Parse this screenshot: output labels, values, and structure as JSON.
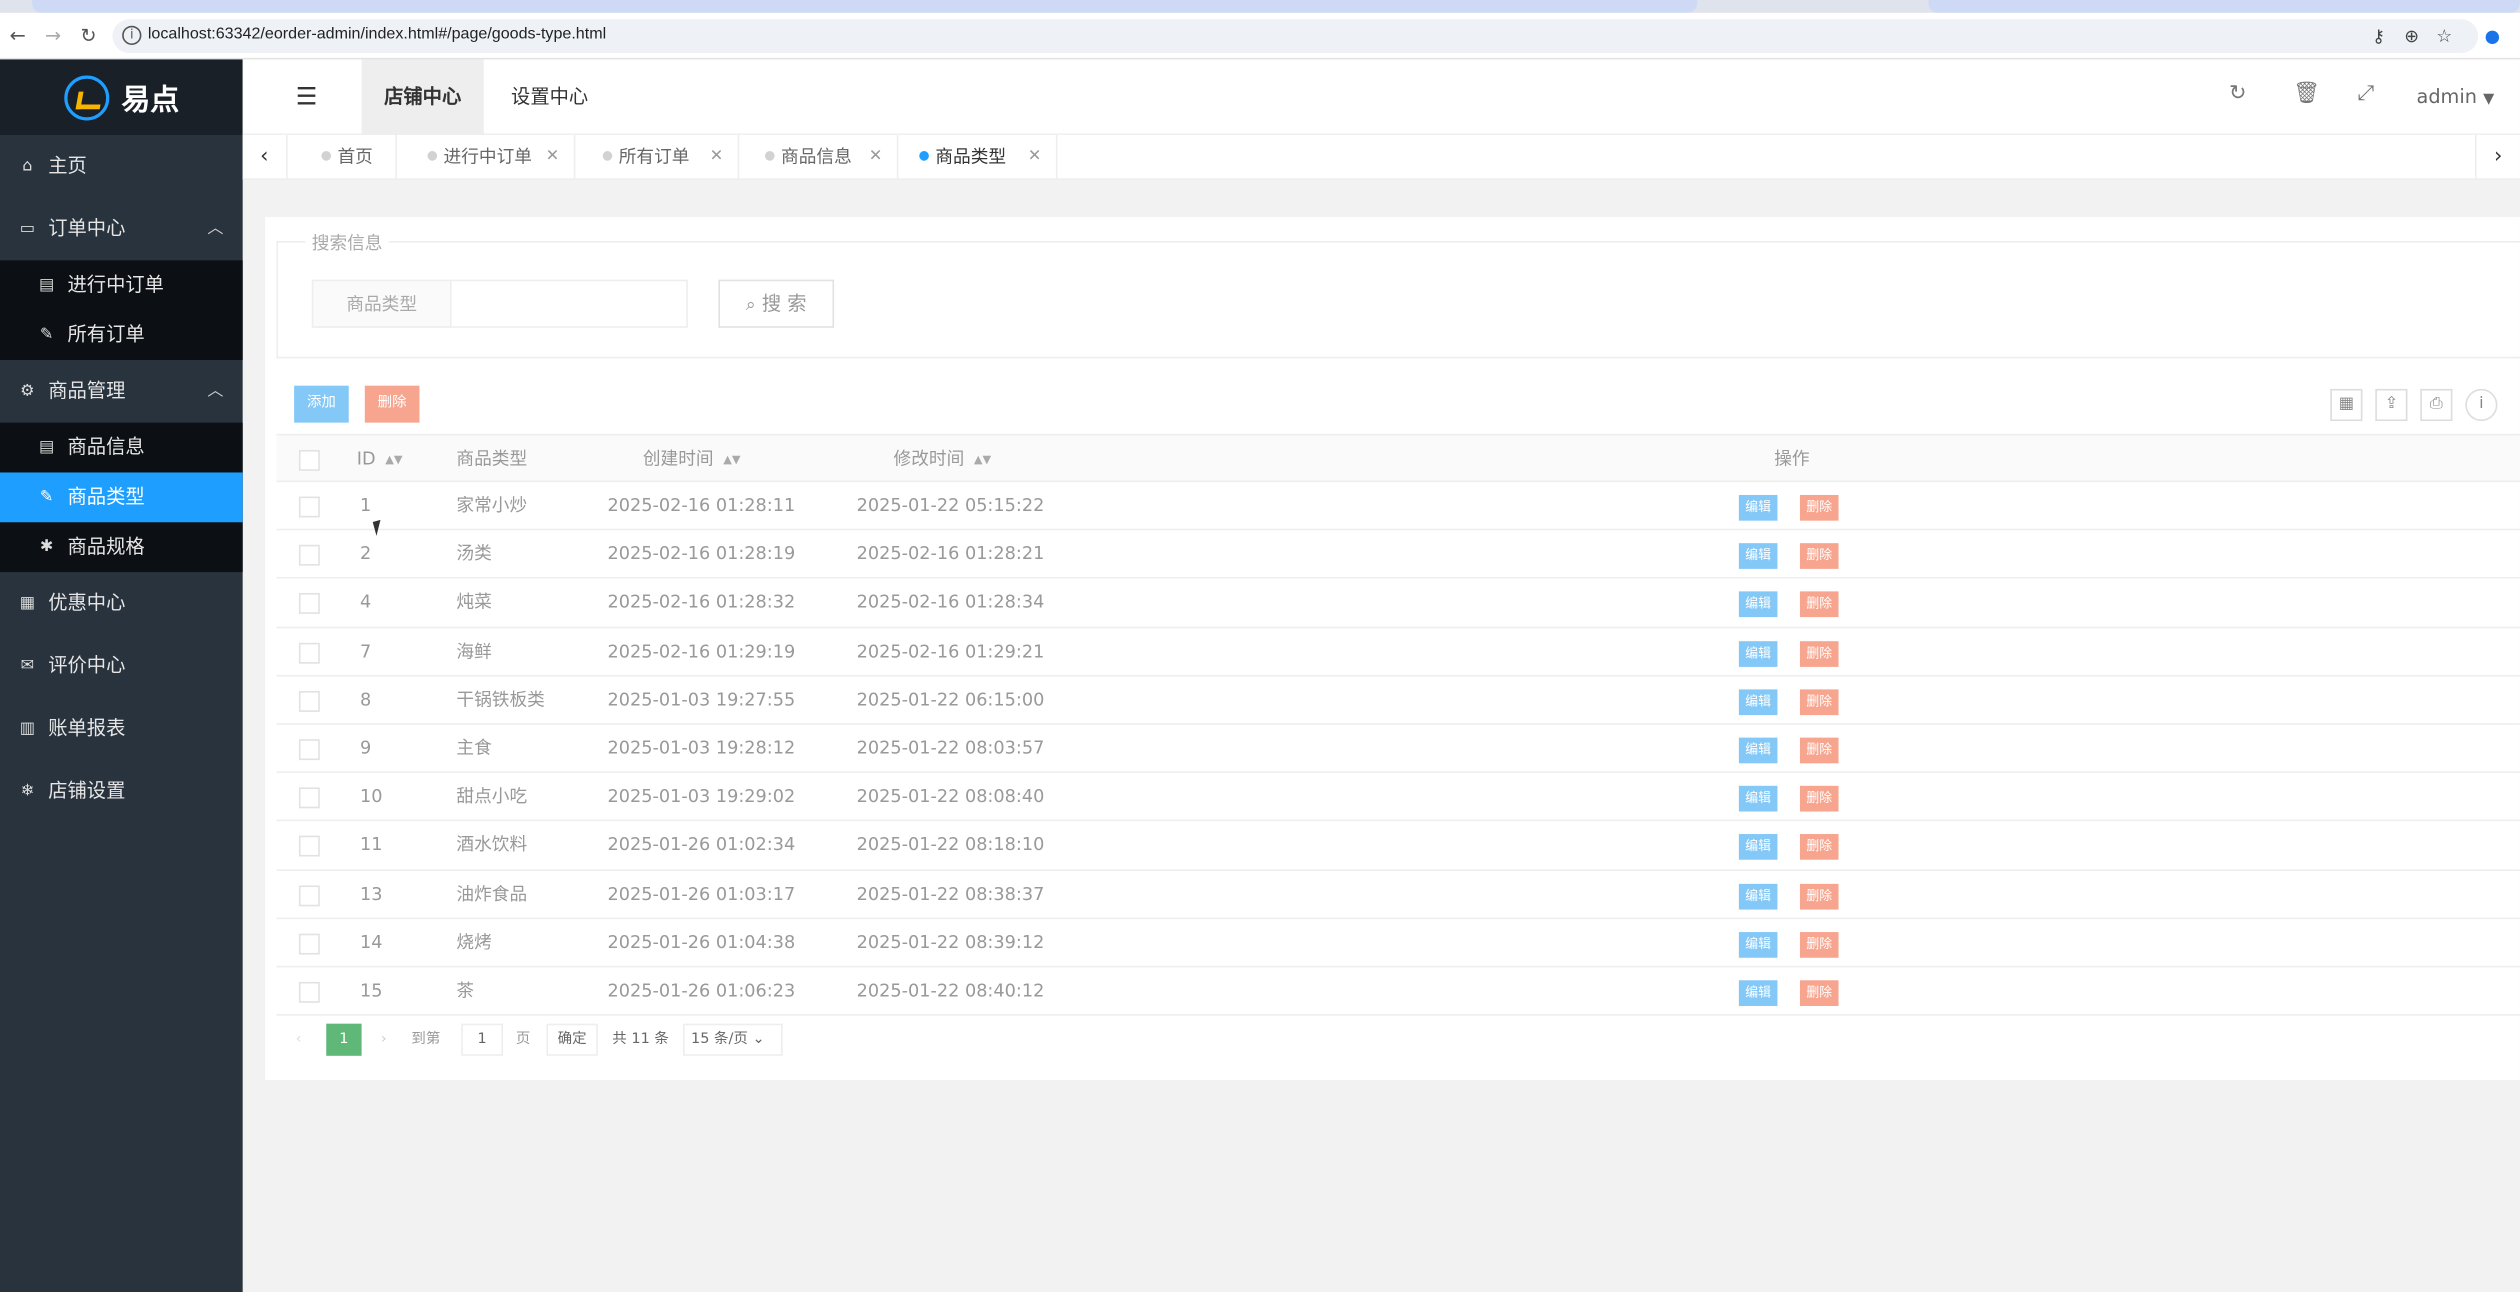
{
  "browser": {
    "url": "localhost:63342/eorder-admin/index.html#/page/goods-type.html"
  },
  "brand": {
    "name": "易点"
  },
  "sidebar": {
    "items": [
      {
        "label": "主页",
        "icon": "home-icon"
      },
      {
        "label": "订单中心",
        "icon": "window-icon",
        "expanded": true
      },
      {
        "label": "进行中订单",
        "icon": "file-icon",
        "sub": true
      },
      {
        "label": "所有订单",
        "icon": "pencil-icon",
        "sub": true
      },
      {
        "label": "商品管理",
        "icon": "gears-icon",
        "expanded": true
      },
      {
        "label": "商品信息",
        "icon": "file-icon",
        "sub": true
      },
      {
        "label": "商品类型",
        "icon": "pencil-icon",
        "sub": true,
        "active": true
      },
      {
        "label": "商品规格",
        "icon": "asterisk-icon",
        "sub": true
      },
      {
        "label": "优惠中心",
        "icon": "calendar-icon"
      },
      {
        "label": "评价中心",
        "icon": "comments-icon"
      },
      {
        "label": "账单报表",
        "icon": "bar-chart-icon"
      },
      {
        "label": "店铺设置",
        "icon": "snowflake-icon"
      }
    ]
  },
  "header": {
    "tabs": [
      "店铺中心",
      "设置中心"
    ],
    "active_tab": "店铺中心",
    "user": "admin"
  },
  "page_tabs": [
    {
      "label": "首页",
      "closable": false
    },
    {
      "label": "进行中订单",
      "closable": true
    },
    {
      "label": "所有订单",
      "closable": true
    },
    {
      "label": "商品信息",
      "closable": true
    },
    {
      "label": "商品类型",
      "closable": true,
      "active": true
    }
  ],
  "search": {
    "legend": "搜索信息",
    "field_label": "商品类型",
    "field_value": "",
    "button": "搜 索"
  },
  "toolbar": {
    "add": "添加",
    "delete": "删除",
    "colors": {
      "add": "#84c8f7",
      "delete": "#f7a58f"
    }
  },
  "table": {
    "columns": [
      "ID",
      "商品类型",
      "创建时间",
      "修改时间",
      "操作"
    ],
    "row_actions": {
      "edit": "编辑",
      "delete": "删除"
    },
    "rows": [
      {
        "id": "1",
        "type": "家常小炒",
        "created": "2025-02-16 01:28:11",
        "modified": "2025-01-22 05:15:22"
      },
      {
        "id": "2",
        "type": "汤类",
        "created": "2025-02-16 01:28:19",
        "modified": "2025-02-16 01:28:21"
      },
      {
        "id": "4",
        "type": "炖菜",
        "created": "2025-02-16 01:28:32",
        "modified": "2025-02-16 01:28:34"
      },
      {
        "id": "7",
        "type": "海鲜",
        "created": "2025-02-16 01:29:19",
        "modified": "2025-02-16 01:29:21"
      },
      {
        "id": "8",
        "type": "干锅铁板类",
        "created": "2025-01-03 19:27:55",
        "modified": "2025-01-22 06:15:00"
      },
      {
        "id": "9",
        "type": "主食",
        "created": "2025-01-03 19:28:12",
        "modified": "2025-01-22 08:03:57"
      },
      {
        "id": "10",
        "type": "甜点小吃",
        "created": "2025-01-03 19:29:02",
        "modified": "2025-01-22 08:08:40"
      },
      {
        "id": "11",
        "type": "酒水饮料",
        "created": "2025-01-26 01:02:34",
        "modified": "2025-01-22 08:18:10"
      },
      {
        "id": "13",
        "type": "油炸食品",
        "created": "2025-01-26 01:03:17",
        "modified": "2025-01-22 08:38:37"
      },
      {
        "id": "14",
        "type": "烧烤",
        "created": "2025-01-26 01:04:38",
        "modified": "2025-01-22 08:39:12"
      },
      {
        "id": "15",
        "type": "茶",
        "created": "2025-01-26 01:06:23",
        "modified": "2025-01-22 08:40:12"
      }
    ]
  },
  "pagination": {
    "current": "1",
    "goto_label": "到第",
    "goto_value": "1",
    "page_unit": "页",
    "confirm": "确定",
    "total": "共 11 条",
    "page_size": "15 条/页"
  }
}
